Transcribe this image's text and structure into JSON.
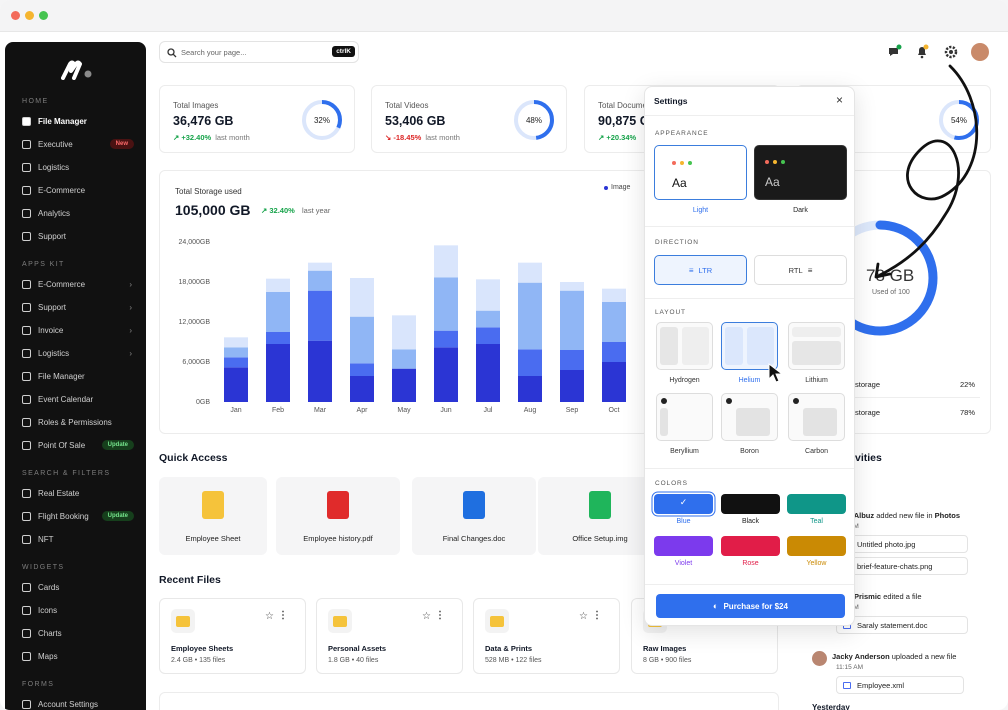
{
  "window_dots": [
    "#f36b5b",
    "#f5b52f",
    "#46c451"
  ],
  "sidebar": {
    "sections": [
      {
        "title": "HOME",
        "items": [
          {
            "label": "File Manager",
            "icon": "folder-icon",
            "active": true
          },
          {
            "label": "Executive",
            "icon": "briefcase-icon",
            "badge": "New"
          },
          {
            "label": "Logistics",
            "icon": "truck-icon"
          },
          {
            "label": "E-Commerce",
            "icon": "cart-icon"
          },
          {
            "label": "Analytics",
            "icon": "chart-icon"
          },
          {
            "label": "Support",
            "icon": "headset-icon"
          }
        ]
      },
      {
        "title": "APPS KIT",
        "items": [
          {
            "label": "E-Commerce",
            "icon": "cart-icon",
            "chevron": true
          },
          {
            "label": "Support",
            "icon": "headset-icon",
            "chevron": true
          },
          {
            "label": "Invoice",
            "icon": "dollar-icon",
            "chevron": true
          },
          {
            "label": "Logistics",
            "icon": "truck-icon",
            "chevron": true
          },
          {
            "label": "File Manager",
            "icon": "folder-icon"
          },
          {
            "label": "Event Calendar",
            "icon": "calendar-icon"
          },
          {
            "label": "Roles & Permissions",
            "icon": "lock-icon"
          },
          {
            "label": "Point Of Sale",
            "icon": "pos-icon",
            "badge": "Update"
          }
        ]
      },
      {
        "title": "SEARCH & FILTERS",
        "items": [
          {
            "label": "Real Estate",
            "icon": "home-icon"
          },
          {
            "label": "Flight Booking",
            "icon": "plane-icon",
            "badge": "Update"
          },
          {
            "label": "NFT",
            "icon": "nft-icon"
          }
        ]
      },
      {
        "title": "WIDGETS",
        "items": [
          {
            "label": "Cards",
            "icon": "cards-icon"
          },
          {
            "label": "Icons",
            "icon": "pen-icon"
          },
          {
            "label": "Charts",
            "icon": "pie-icon"
          },
          {
            "label": "Maps",
            "icon": "pin-icon"
          }
        ]
      },
      {
        "title": "FORMS",
        "items": [
          {
            "label": "Account Settings",
            "icon": "user-gear-icon"
          }
        ]
      }
    ]
  },
  "search": {
    "placeholder": "Search your page...",
    "shortcut": "ctrlK"
  },
  "stats": [
    {
      "label": "Total Images",
      "value": "36,476 GB",
      "delta": "+32.40%",
      "dir": "up",
      "period": "last month",
      "percent": 32
    },
    {
      "label": "Total Videos",
      "value": "53,406 GB",
      "delta": "-18.45%",
      "dir": "down",
      "period": "last month",
      "percent": 48
    },
    {
      "label": "Total Docume",
      "value": "90,875 G",
      "delta": "+20.34%",
      "dir": "up",
      "period": "",
      "percent": 0
    },
    {
      "label": "",
      "value": "GB",
      "delta": "",
      "dir": "up",
      "period": "",
      "percent": 54
    }
  ],
  "storage": {
    "title": "Total Storage used",
    "value": "105,000 GB",
    "delta": "32.40%",
    "period": "last year",
    "legend_label": "Image",
    "gauge_value": "78 GB",
    "gauge_sub": "Used of 100",
    "gauge_percent": 78
  },
  "chart_data": {
    "type": "bar",
    "stacked": true,
    "categories": [
      "Jan",
      "Feb",
      "Mar",
      "Apr",
      "May",
      "Jun",
      "Jul",
      "Aug",
      "Sep",
      "Oct"
    ],
    "y_ticks": [
      "0GB",
      "6,000GB",
      "12,000GB",
      "18,000GB",
      "24,000GB"
    ],
    "ylim": [
      0,
      24000
    ],
    "series": [
      {
        "name": "Image",
        "color": "#2b35d4",
        "values": [
          5200,
          8700,
          9200,
          3900,
          5000,
          8200,
          8700,
          3900,
          4800,
          6000
        ]
      },
      {
        "name": "",
        "color": "#4a6cf0",
        "values": [
          1500,
          1800,
          7500,
          1900,
          0,
          2500,
          2500,
          4000,
          3000,
          3000
        ]
      },
      {
        "name": "",
        "color": "#90b6f5",
        "values": [
          1500,
          6000,
          3000,
          7000,
          2900,
          8000,
          2500,
          10000,
          8900,
          6000
        ]
      },
      {
        "name": "",
        "color": "#d9e5fc",
        "values": [
          1500,
          2000,
          1200,
          5800,
          5100,
          4800,
          4700,
          3000,
          1300,
          2000
        ]
      }
    ]
  },
  "quick_access": {
    "title": "Quick Access",
    "items": [
      {
        "name": "Employee Sheet",
        "icon": "folder-icon",
        "color": "#f5c33b"
      },
      {
        "name": "Employee history.pdf",
        "icon": "pdf-icon",
        "color": "#e02b2b"
      },
      {
        "name": "Final Changes.doc",
        "icon": "doc-icon",
        "color": "#1f6fe0"
      },
      {
        "name": "Office Setup.img",
        "icon": "image-file-icon",
        "color": "#1fb55b"
      }
    ]
  },
  "recent_files": {
    "title": "Recent Files",
    "items": [
      {
        "name": "Employee Sheets",
        "size": "2.4 GB",
        "files": "135 files"
      },
      {
        "name": "Personal Assets",
        "size": "1.8 GB",
        "files": "40 files"
      },
      {
        "name": "Data & Prints",
        "size": "528 MB",
        "files": "122 files"
      },
      {
        "name": "Raw Images",
        "size": "8 GB",
        "files": "900 files"
      }
    ]
  },
  "storage_rows": [
    {
      "label": "storage",
      "value": "22%"
    },
    {
      "label": "storage",
      "value": "78%"
    }
  ],
  "activities": {
    "title": "vities",
    "items": [
      {
        "who": "r Albuz",
        "text": "added new file in",
        "target": "Photos",
        "time": "PM",
        "files": [
          "Untitled photo.jpg",
          "brief-feature-chats.png"
        ]
      },
      {
        "who": "r Prismic",
        "text": "edited a file",
        "target": "",
        "time": "PM",
        "files": [
          "Saraly statement.doc"
        ]
      },
      {
        "who": "Jacky Anderson",
        "text": "uploaded a new file",
        "target": "",
        "time": "11:15 AM",
        "files": [
          "Employee.xml"
        ]
      }
    ],
    "footer": "Yesterday"
  },
  "settings": {
    "title": "Settings",
    "appearance_label": "APPEARANCE",
    "themes": [
      {
        "label": "Light",
        "sample": "Aa",
        "selected": true
      },
      {
        "label": "Dark",
        "sample": "Aa"
      }
    ],
    "direction_label": "DIRECTION",
    "directions": [
      {
        "label": "LTR",
        "selected": true
      },
      {
        "label": "RTL"
      }
    ],
    "layout_label": "LAYOUT",
    "layouts": [
      "Hydrogen",
      "Helium",
      "Lithium",
      "Beryllium",
      "Boron",
      "Carbon"
    ],
    "selected_layout": "Helium",
    "colors_label": "COLORS",
    "colors": [
      {
        "label": "Blue",
        "hex": "#2f6fed",
        "selected": true
      },
      {
        "label": "Black",
        "hex": "#111111"
      },
      {
        "label": "Teal",
        "hex": "#0f9688"
      },
      {
        "label": "Violet",
        "hex": "#7c3aed"
      },
      {
        "label": "Rose",
        "hex": "#e11d48"
      },
      {
        "label": "Yellow",
        "hex": "#ca8a04"
      }
    ],
    "purchase_label": "Purchase for $24"
  }
}
